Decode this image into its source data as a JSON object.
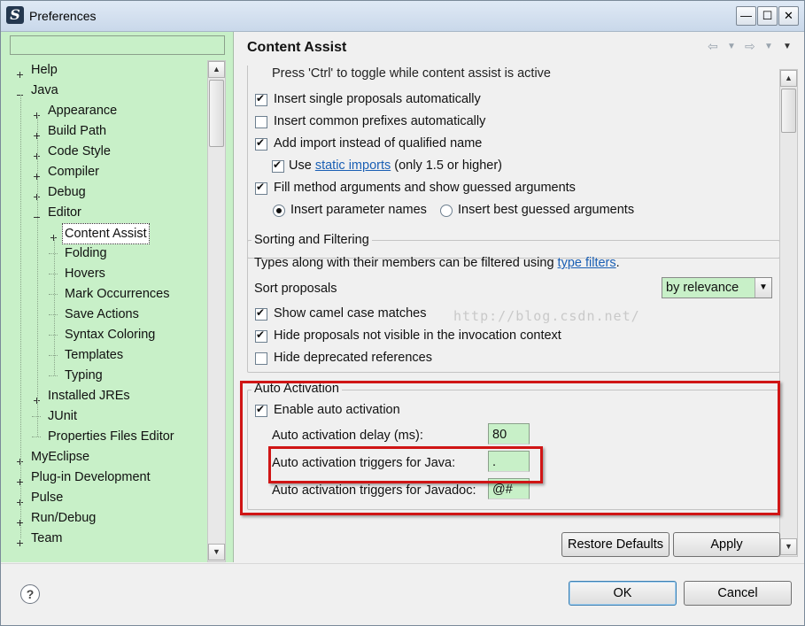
{
  "window": {
    "title": "Preferences"
  },
  "caption_buttons": {
    "minimize": "—",
    "maximize": "☐",
    "close": "✕"
  },
  "filter": {
    "placeholder": ""
  },
  "tree": [
    {
      "label": "Help"
    },
    {
      "label": "Java"
    },
    {
      "label": "Appearance"
    },
    {
      "label": "Build Path"
    },
    {
      "label": "Code Style"
    },
    {
      "label": "Compiler"
    },
    {
      "label": "Debug"
    },
    {
      "label": "Editor"
    },
    {
      "label": "Content Assist"
    },
    {
      "label": "Folding"
    },
    {
      "label": "Hovers"
    },
    {
      "label": "Mark Occurrences"
    },
    {
      "label": "Save Actions"
    },
    {
      "label": "Syntax Coloring"
    },
    {
      "label": "Templates"
    },
    {
      "label": "Typing"
    },
    {
      "label": "Installed JREs"
    },
    {
      "label": "JUnit"
    },
    {
      "label": "Properties Files Editor"
    },
    {
      "label": "MyEclipse"
    },
    {
      "label": "Plug-in Development"
    },
    {
      "label": "Pulse"
    },
    {
      "label": "Run/Debug"
    },
    {
      "label": "Team"
    }
  ],
  "page": {
    "title": "Content Assist"
  },
  "insertion": {
    "partial_text": "Press 'Ctrl' to toggle while content assist is active",
    "single_proposals": {
      "label": "Insert single proposals automatically",
      "checked": true
    },
    "common_prefixes": {
      "label": "Insert common prefixes automatically",
      "checked": false
    },
    "add_import": {
      "label": "Add import instead of qualified name",
      "checked": true
    },
    "static_imports": {
      "prefix": "Use",
      "link": "static imports",
      "suffix": "(only 1.5 or higher)",
      "checked": true
    },
    "fill_method_args": {
      "label": "Fill method arguments and show guessed arguments",
      "checked": true
    },
    "param_names": {
      "label": "Insert parameter names",
      "selected": true
    },
    "best_guessed": {
      "label": "Insert best guessed arguments",
      "selected": false
    }
  },
  "sorting": {
    "title": "Sorting and Filtering",
    "types_text": "Types along with their members can be filtered using",
    "types_link": "type filters",
    "types_end": ".",
    "sort_label": "Sort proposals",
    "sort_value": "by relevance",
    "camel_case": {
      "label": "Show camel case matches",
      "checked": true
    },
    "hide_not_visible": {
      "label": "Hide proposals not visible in the invocation context",
      "checked": true
    },
    "hide_deprecated": {
      "label": "Hide deprecated references",
      "checked": false
    }
  },
  "auto_activation": {
    "title": "Auto Activation",
    "enable": {
      "label": "Enable auto activation",
      "checked": true
    },
    "delay_label": "Auto activation delay (ms):",
    "delay_value": "80",
    "java_label": "Auto activation triggers for Java:",
    "java_value": ".",
    "javadoc_label": "Auto activation triggers for Javadoc:",
    "javadoc_value": "@#"
  },
  "watermark": "http://blog.csdn.net/",
  "buttons": {
    "restore_defaults": "Restore Defaults",
    "apply": "Apply",
    "ok": "OK",
    "cancel": "Cancel",
    "help": "?"
  },
  "colors": {
    "pane_bg": "#c8f0c8",
    "highlight": "#d01515",
    "link": "#1a5fb4"
  }
}
